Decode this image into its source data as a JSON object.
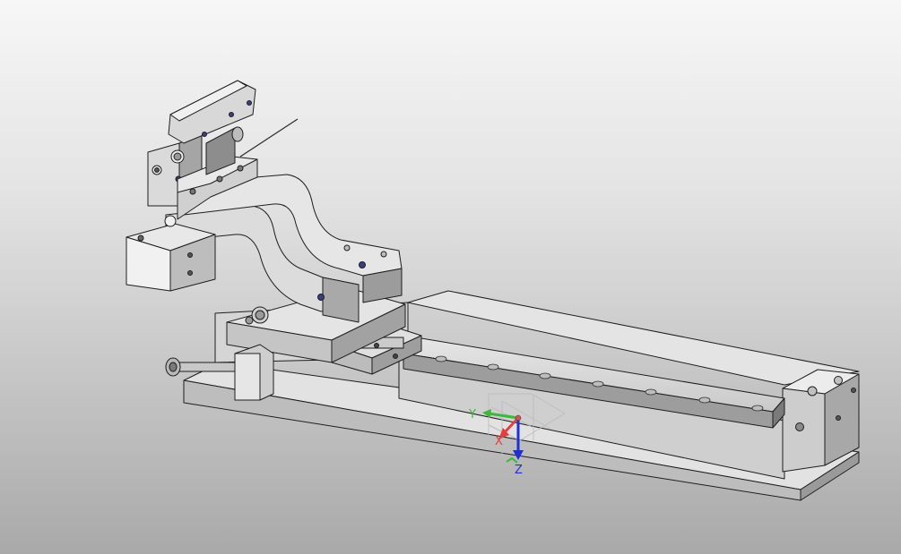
{
  "viewport": {
    "background_top": "#f7f7f7",
    "background_bottom": "#a9a9a9"
  },
  "triad": {
    "x_label": "X",
    "y_label": "Y",
    "z_label": "Z",
    "x_color": "#e04040",
    "y_color": "#3cb83c",
    "z_color": "#1f2fd6"
  },
  "model": {
    "part_fill": "#d6d6d6",
    "part_light": "#e9e9e9",
    "part_dark": "#8e8e8e",
    "edge": "#1e1e1e"
  }
}
